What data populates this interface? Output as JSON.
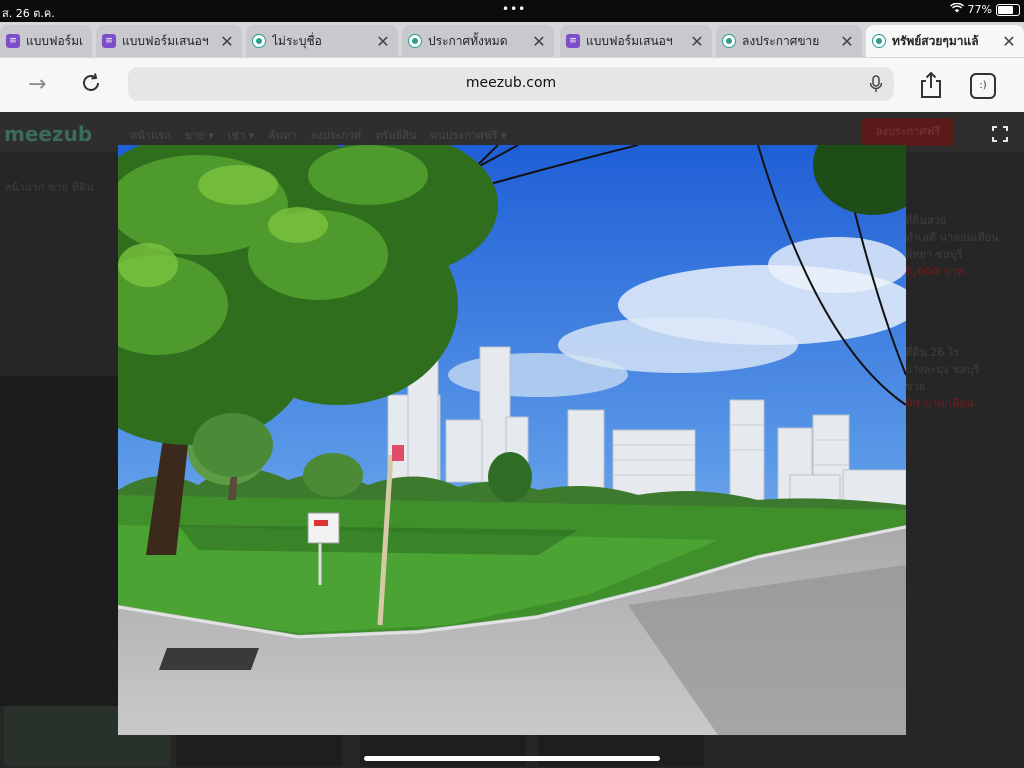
{
  "status": {
    "time": "ส. 26 ต.ค.",
    "battery_percent": 77,
    "battery_label": "77%"
  },
  "tabs": [
    {
      "label": "แบบฟอร์มเ",
      "icon": "form-icon",
      "active": false,
      "x": 0,
      "w": 92
    },
    {
      "label": "แบบฟอร์มเสนอฯ",
      "icon": "form-icon",
      "active": false
    },
    {
      "label": "ไม่ระบุชื่อ",
      "icon": "meezub-icon",
      "active": false
    },
    {
      "label": "ประกาศทั้งหมด",
      "icon": "meezub-icon",
      "active": false
    },
    {
      "label": "แบบฟอร์มเสนอฯ",
      "icon": "form-icon",
      "active": false
    },
    {
      "label": "ลงประกาศขาย",
      "icon": "meezub-icon",
      "active": false
    },
    {
      "label": "ทรัพย์สวยๆมาแล้",
      "icon": "meezub-icon",
      "active": true
    }
  ],
  "address": {
    "url": "meezub.com"
  },
  "site": {
    "logo": "meezub",
    "menu": [
      "หน้าแรก",
      "ขาย ▾",
      "เช่า ▾",
      "ค้นหา",
      "ลงประกาศ",
      "ทรัพย์สิน",
      "คนประกาศฟรี ▾"
    ],
    "post_button": "ลงประกาศฟรี",
    "crumbs": "หน้าแรก   ขาย   ที่ดิน",
    "listings": [
      {
        "line1": "ที่ดินสวย",
        "line2": "ทำเลดี นาจอมเทียน",
        "line3": "พัทยา ชลบุรี",
        "price": "5,000 บาท"
      },
      {
        "line1": "ที่ดิน 26 ไร่",
        "line2": "บางละมุง ชลบุรี",
        "line3": "ขาย",
        "price": "00 บาท/เดือน"
      }
    ]
  },
  "photo": {
    "description_alt": "Vacant land plot with grass, trees, road and high-rise buildings"
  }
}
